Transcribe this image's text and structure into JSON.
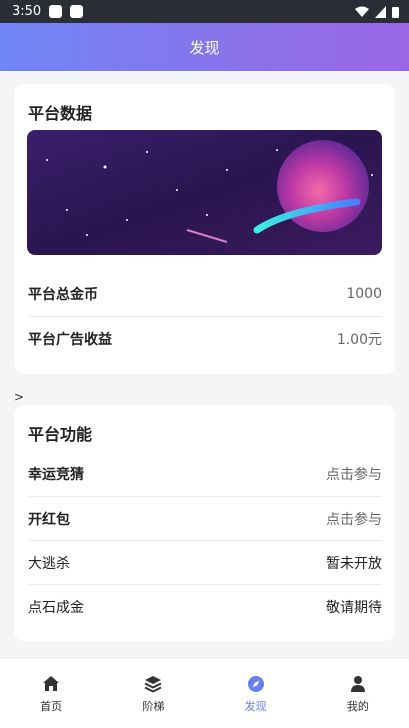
{
  "status_bar": {
    "time": "3:50"
  },
  "header": {
    "title": "发现"
  },
  "platform_data": {
    "title": "平台数据",
    "rows": [
      {
        "label": "平台总金币",
        "value": "1000"
      },
      {
        "label": "平台广告收益",
        "value": "1.00元"
      }
    ]
  },
  "chevron": ">",
  "platform_features": {
    "title": "平台功能",
    "rows": [
      {
        "label": "幸运竞猜",
        "value": "点击参与"
      },
      {
        "label": "开红包",
        "value": "点击参与"
      },
      {
        "label": "大逃杀",
        "value": "暂未开放"
      },
      {
        "label": "点石成金",
        "value": "敬请期待"
      }
    ]
  },
  "tabbar": {
    "items": [
      {
        "label": "首页",
        "icon": "home-icon"
      },
      {
        "label": "阶梯",
        "icon": "layers-icon"
      },
      {
        "label": "发现",
        "icon": "compass-icon",
        "active": true
      },
      {
        "label": "我的",
        "icon": "user-icon"
      }
    ]
  },
  "colors": {
    "accent": "#6a7ff0",
    "header_start": "#6f86f6",
    "header_end": "#9a66e8"
  }
}
